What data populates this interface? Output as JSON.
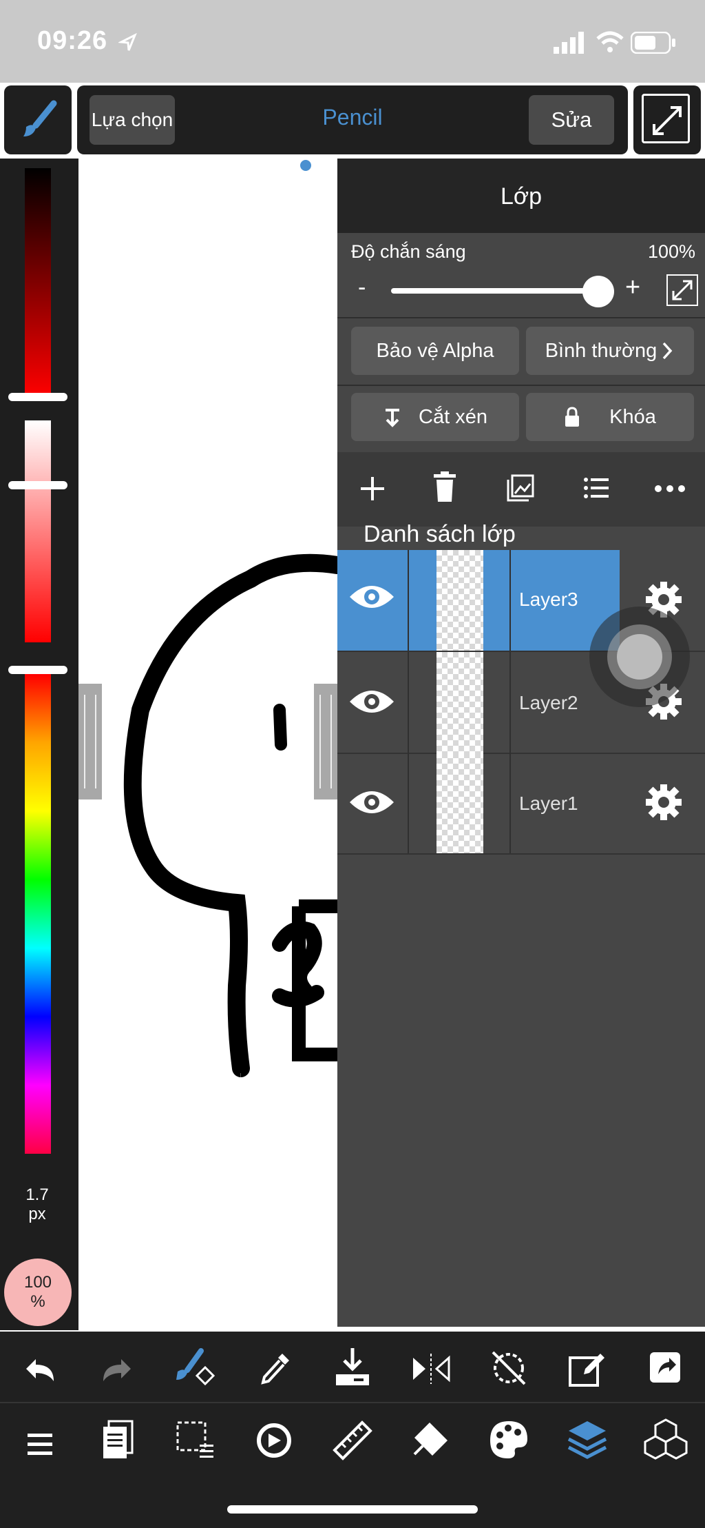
{
  "status": {
    "time": "09:26"
  },
  "toolbar": {
    "select_label": "Lựa chọn",
    "tool_name": "Pencil",
    "edit_label": "Sửa"
  },
  "colorbar": {
    "brush_size": "1.7",
    "brush_unit": "px",
    "opacity": "100",
    "opacity_unit": "%"
  },
  "panel": {
    "title": "Lớp",
    "opacity_label": "Độ chắn sáng",
    "opacity_value": "100%",
    "opacity_level": 1.0,
    "minus": "-",
    "plus": "+",
    "alpha_protect": "Bảo vệ Alpha",
    "blend_mode": "Bình thường",
    "clipping": "Cắt xén",
    "lock": "Khóa",
    "list_title": "Danh sách lớp",
    "layers": [
      {
        "name": "Layer3",
        "selected": true
      },
      {
        "name": "Layer2",
        "selected": false
      },
      {
        "name": "Layer1",
        "selected": false
      }
    ]
  },
  "colors": {
    "accent": "#4a90d0",
    "panel": "#464646",
    "dark": "#1f1f1f"
  }
}
